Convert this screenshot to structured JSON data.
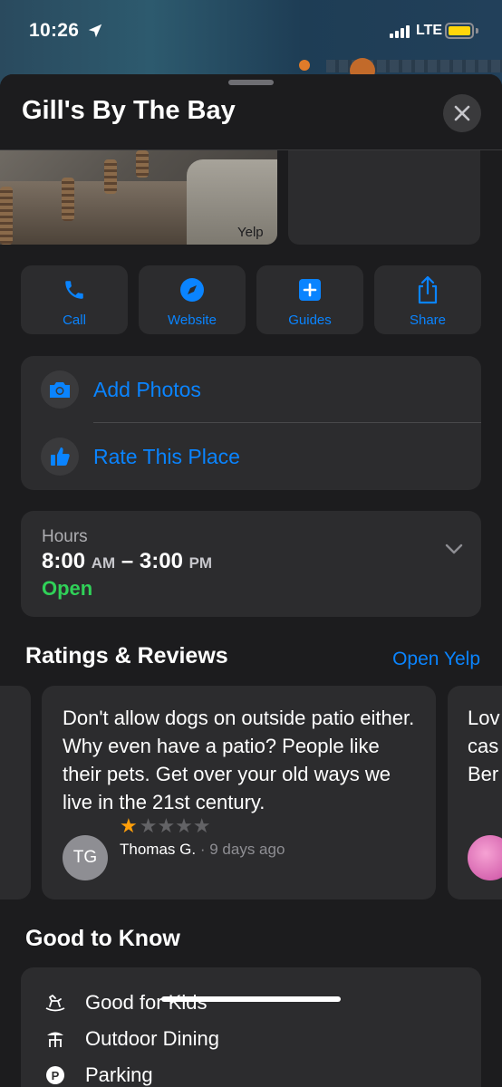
{
  "status_bar": {
    "time": "10:26",
    "network": "LTE"
  },
  "place": {
    "title": "Gill's By The Bay"
  },
  "photos": {
    "credit": "Yelp"
  },
  "actions": [
    {
      "label": "Call",
      "icon": "phone-icon"
    },
    {
      "label": "Website",
      "icon": "compass-icon"
    },
    {
      "label": "Guides",
      "icon": "plus-square-icon"
    },
    {
      "label": "Share",
      "icon": "share-icon"
    }
  ],
  "contribute": {
    "add_photos": "Add Photos",
    "rate_place": "Rate This Place"
  },
  "hours": {
    "label": "Hours",
    "open_time": "8:00",
    "open_ampm": "AM",
    "dash": "–",
    "close_time": "3:00",
    "close_ampm": "PM",
    "status": "Open"
  },
  "reviews": {
    "heading": "Ratings & Reviews",
    "open_link": "Open Yelp",
    "items": [
      {
        "text": "Don't allow dogs on outside patio either. Why even have a patio? People like their pets. Get over your old ways we live in the 21st century.",
        "initials": "TG",
        "rating": 1,
        "stars_filled": "★",
        "stars_empty": "★★★★",
        "author": "Thomas G.",
        "separator": "·",
        "ago": "9 days ago"
      }
    ],
    "peek": {
      "line1": "Lov",
      "line2": "cas",
      "line3": "Ber"
    }
  },
  "good_to_know": {
    "heading": "Good to Know",
    "items": [
      {
        "label": "Good for Kids",
        "icon": "rocking-horse-icon"
      },
      {
        "label": "Outdoor Dining",
        "icon": "umbrella-table-icon"
      },
      {
        "label": "Parking",
        "icon": "parking-icon"
      }
    ]
  },
  "colors": {
    "accent": "#0a84ff",
    "open": "#30d158",
    "star": "#ff9f0a",
    "battery": "#ffd60a"
  }
}
